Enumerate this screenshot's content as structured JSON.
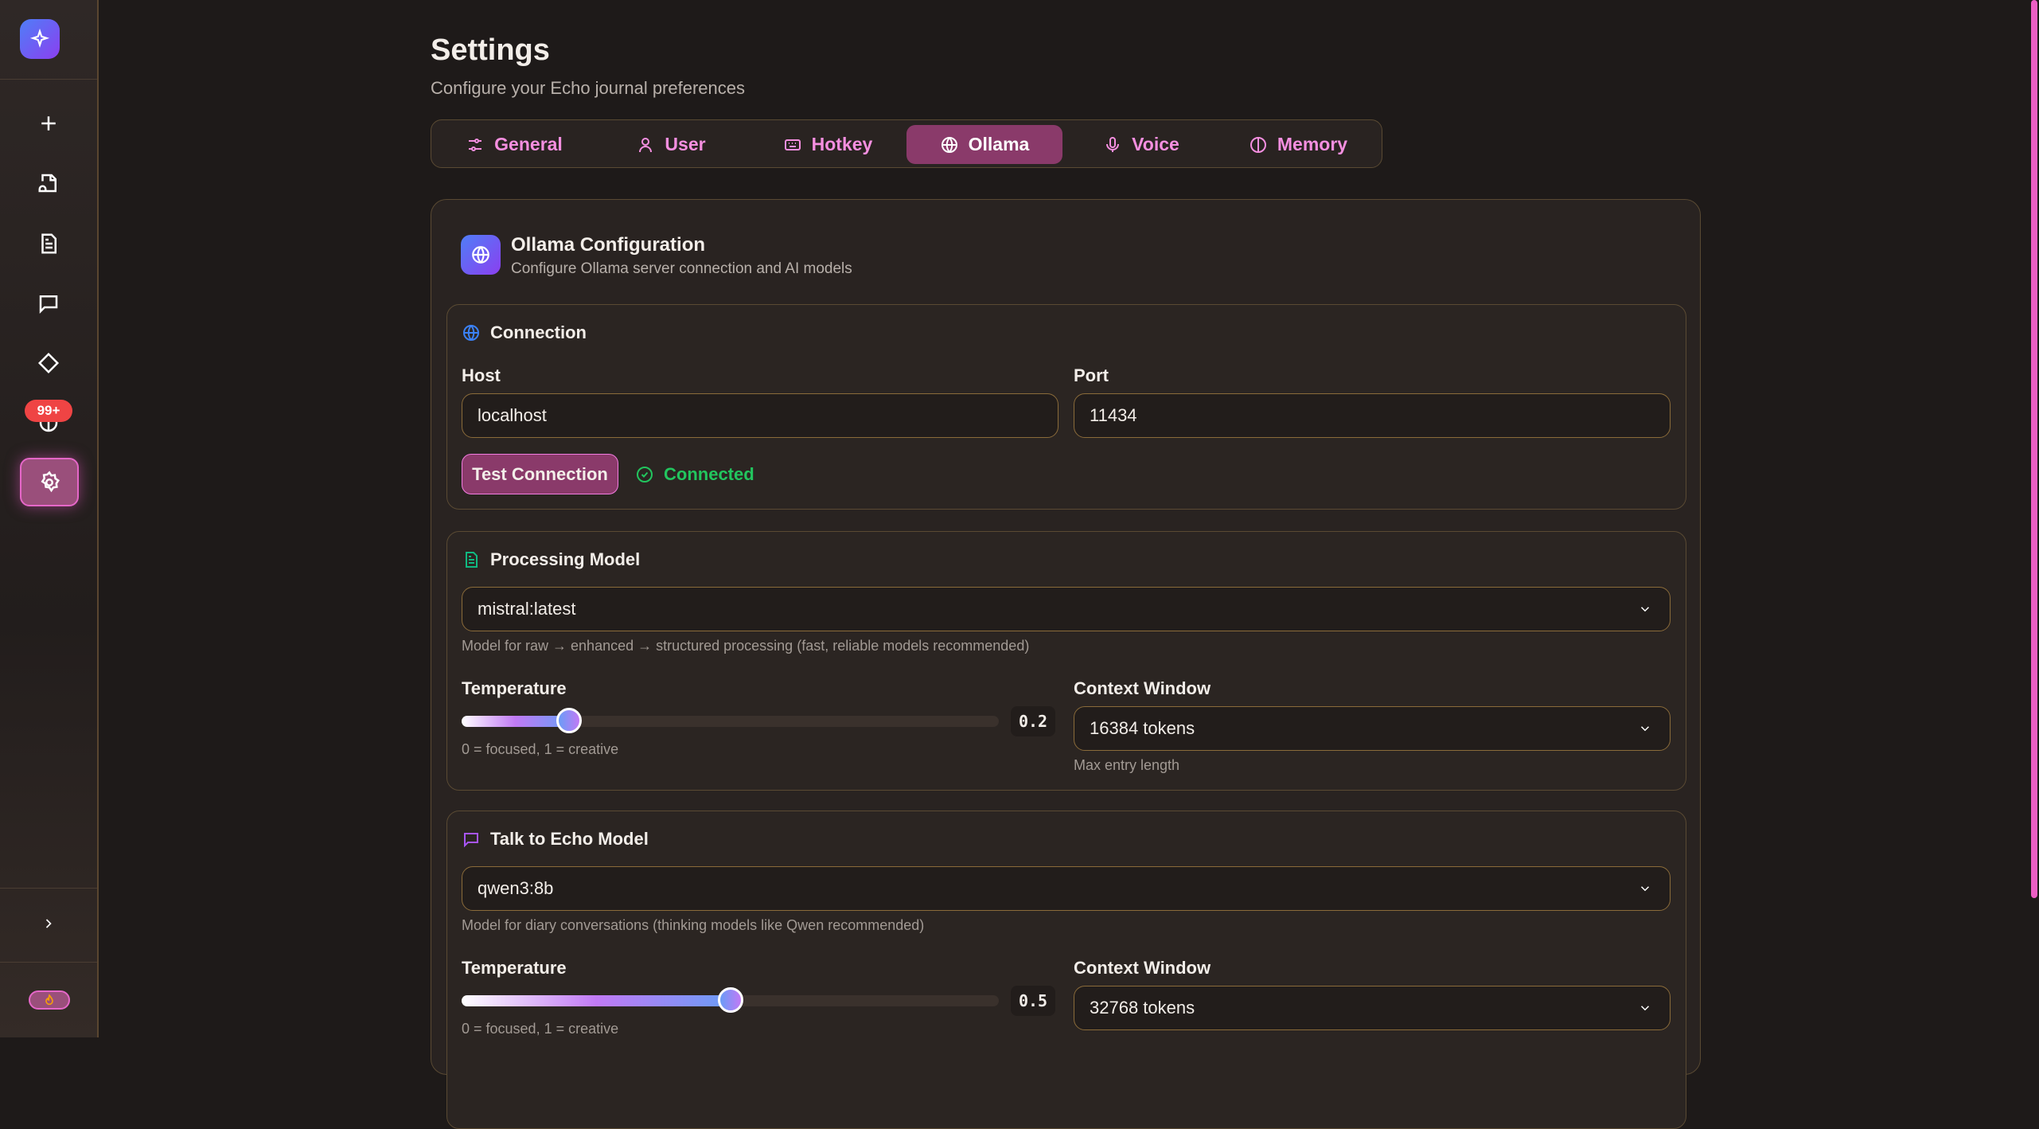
{
  "sidebar": {
    "badge": "99+",
    "items": [
      "new-entry",
      "voice-file",
      "document",
      "chat",
      "diamond",
      "brain",
      "settings"
    ]
  },
  "header": {
    "title": "Settings",
    "subtitle": "Configure your Echo journal preferences"
  },
  "tabs": [
    {
      "label": "General",
      "icon": "sliders-icon"
    },
    {
      "label": "User",
      "icon": "user-icon"
    },
    {
      "label": "Hotkey",
      "icon": "keyboard-icon"
    },
    {
      "label": "Ollama",
      "icon": "globe-icon",
      "active": true
    },
    {
      "label": "Voice",
      "icon": "mic-icon"
    },
    {
      "label": "Memory",
      "icon": "brain-icon"
    }
  ],
  "card": {
    "title": "Ollama Configuration",
    "subtitle": "Configure Ollama server connection and AI models"
  },
  "connection": {
    "title": "Connection",
    "host_label": "Host",
    "host_value": "localhost",
    "port_label": "Port",
    "port_value": "11434",
    "test_button": "Test Connection",
    "status": "Connected"
  },
  "processing": {
    "title": "Processing Model",
    "model": "mistral:latest",
    "model_help": "Model for raw → enhanced → structured processing (fast, reliable models recommended)",
    "temp_label": "Temperature",
    "temp_value": "0.2",
    "temp": 0.2,
    "temp_help": "0 = focused, 1 = creative",
    "ctx_label": "Context Window",
    "ctx_value": "16384 tokens",
    "ctx_help": "Max entry length"
  },
  "talk": {
    "title": "Talk to Echo Model",
    "model": "qwen3:8b",
    "model_help": "Model for diary conversations (thinking models like Qwen recommended)",
    "temp_label": "Temperature",
    "temp_value": "0.5",
    "temp": 0.5,
    "temp_help": "0 = focused, 1 = creative",
    "ctx_label": "Context Window",
    "ctx_value": "32768 tokens"
  },
  "colors": {
    "accent": "#f58fe0",
    "active_tab": "#8a3a6a",
    "success": "#22c55e",
    "border": "#5a4a33"
  }
}
